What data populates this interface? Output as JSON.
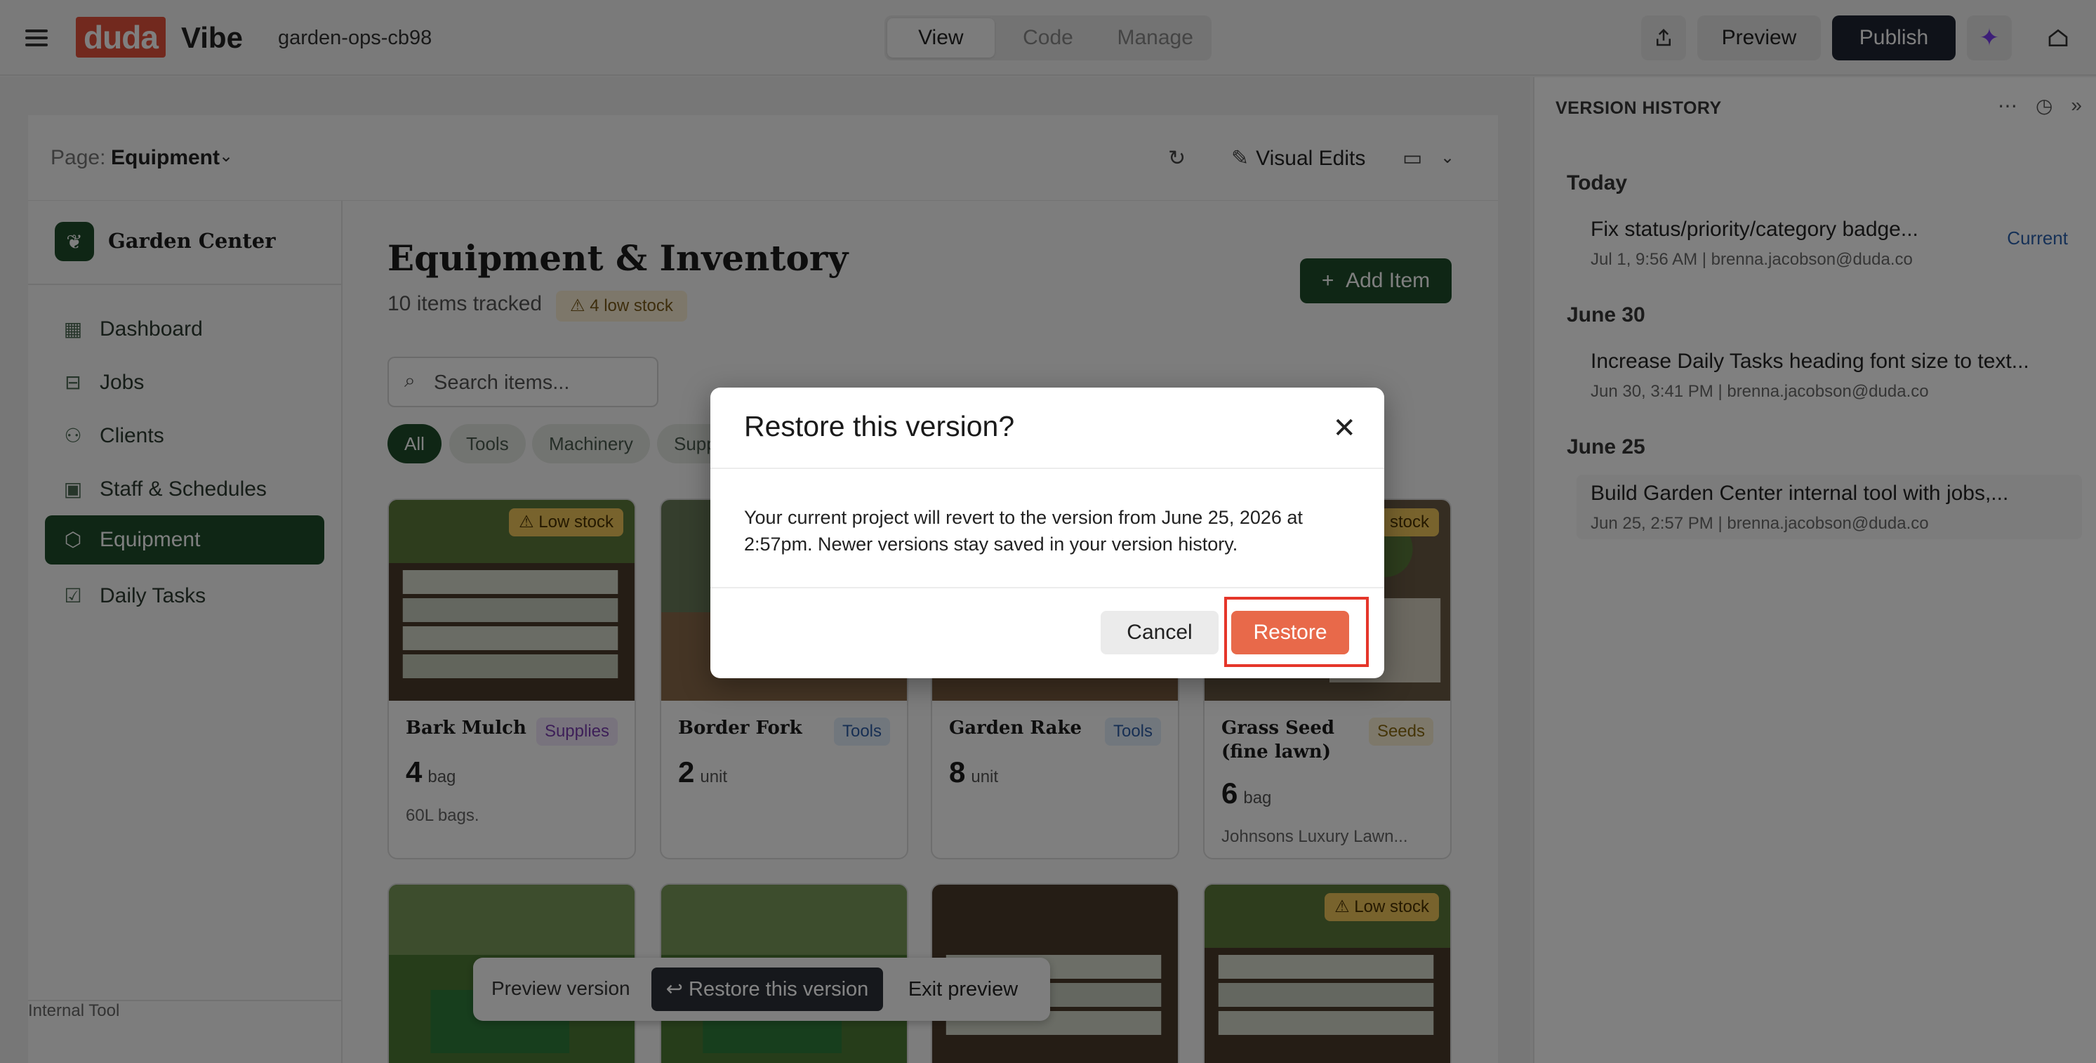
{
  "topbar": {
    "logo": "duda",
    "product": "Vibe",
    "project_name": "garden-ops-cb98",
    "tabs": [
      "View",
      "Code",
      "Manage"
    ],
    "active_tab": "View",
    "preview_label": "Preview",
    "publish_label": "Publish"
  },
  "editor": {
    "page_label": "Page:",
    "page_value": "Equipment",
    "visual_edits_label": "Visual Edits"
  },
  "app": {
    "brand": "Garden Center",
    "nav": [
      {
        "label": "Dashboard",
        "icon": "dashboard-icon"
      },
      {
        "label": "Jobs",
        "icon": "briefcase-icon"
      },
      {
        "label": "Clients",
        "icon": "users-icon"
      },
      {
        "label": "Staff & Schedules",
        "icon": "calendar-icon"
      },
      {
        "label": "Equipment",
        "icon": "box-icon",
        "active": true
      },
      {
        "label": "Daily Tasks",
        "icon": "checkbox-icon"
      }
    ],
    "footer": "Internal Tool",
    "title": "Equipment & Inventory",
    "items_tracked": "10 items tracked",
    "low_stock_badge": "4 low stock",
    "add_item_label": "Add Item",
    "search_placeholder": "Search items...",
    "filters": [
      "All",
      "Tools",
      "Machinery",
      "Supp"
    ],
    "cards": [
      {
        "name": "Bark Mulch",
        "category": "Supplies",
        "qty": "4",
        "unit": "bag",
        "desc": "60L bags.",
        "stock": "Low stock"
      },
      {
        "name": "Border Fork",
        "category": "Tools",
        "qty": "2",
        "unit": "unit",
        "desc": "",
        "stock": ""
      },
      {
        "name": "Garden Rake",
        "category": "Tools",
        "qty": "8",
        "unit": "unit",
        "desc": "",
        "stock": ""
      },
      {
        "name": "Grass Seed (fine lawn)",
        "category": "Seeds",
        "qty": "6",
        "unit": "bag",
        "desc": "Johnsons Luxury Lawn...",
        "stock": "stock"
      }
    ],
    "row2_stock": "Low stock"
  },
  "version_history": {
    "title": "VERSION HISTORY",
    "groups": [
      {
        "day": "Today",
        "entries": [
          {
            "title": "Fix status/priority/category badge...",
            "meta": "Jul 1, 9:56 AM | brenna.jacobson@duda.co",
            "tag": "Current"
          }
        ]
      },
      {
        "day": "June 30",
        "entries": [
          {
            "title": "Increase Daily Tasks heading font size to text...",
            "meta": "Jun 30, 3:41 PM | brenna.jacobson@duda.co"
          }
        ]
      },
      {
        "day": "June 25",
        "entries": [
          {
            "title": "Build Garden Center internal tool with jobs,...",
            "meta": "Jun 25, 2:57 PM | brenna.jacobson@duda.co"
          }
        ]
      }
    ]
  },
  "preview_bar": {
    "label": "Preview version",
    "restore_label": "Restore this version",
    "exit_label": "Exit preview"
  },
  "modal": {
    "title": "Restore this version?",
    "body": "Your current project will revert to the version from June 25, 2026 at 2:57pm. Newer versions stay saved in your version history.",
    "cancel_label": "Cancel",
    "restore_label": "Restore"
  },
  "colors": {
    "brand_green": "#1e4d2b",
    "duda_orange": "#e5533c",
    "restore_orange": "#e8694a",
    "highlight_red": "#e5362a"
  }
}
